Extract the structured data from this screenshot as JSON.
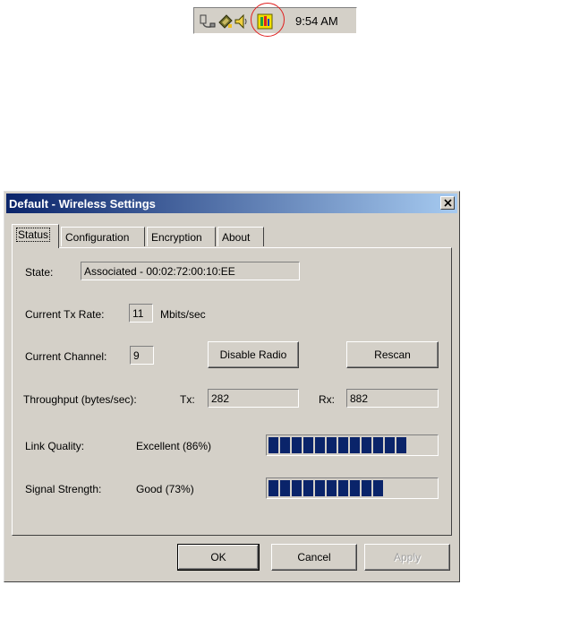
{
  "tray": {
    "clock": "9:54 AM",
    "icons": [
      "network-icon",
      "pc-card-icon",
      "speaker-icon",
      "wireless-utility-icon"
    ]
  },
  "window": {
    "title": "Default - Wireless Settings",
    "tabs": [
      {
        "label": "Status",
        "active": true
      },
      {
        "label": "Configuration",
        "active": false
      },
      {
        "label": "Encryption",
        "active": false
      },
      {
        "label": "About",
        "active": false
      }
    ],
    "status": {
      "state_label": "State:",
      "state_value": "Associated - 00:02:72:00:10:EE",
      "tx_rate_label": "Current Tx Rate:",
      "tx_rate_value": "11",
      "tx_rate_unit": "Mbits/sec",
      "channel_label": "Current Channel:",
      "channel_value": "9",
      "disable_radio_label": "Disable Radio",
      "rescan_label": "Rescan",
      "throughput_label": "Throughput (bytes/sec):",
      "tx_label": "Tx:",
      "tx_value": "282",
      "rx_label": "Rx:",
      "rx_value": "882",
      "link_quality_label": "Link Quality:",
      "link_quality_value": "Excellent (86%)",
      "link_quality_percent": 86,
      "signal_strength_label": "Signal Strength:",
      "signal_strength_value": "Good (73%)",
      "signal_strength_percent": 73
    },
    "buttons": {
      "ok": "OK",
      "cancel": "Cancel",
      "apply": "Apply"
    }
  },
  "colors": {
    "titlebar_start": "#0a246a",
    "titlebar_end": "#a6caf0",
    "face": "#d4d0c8",
    "bar_segment": "#0a246a",
    "highlight_circle": "#e02020"
  }
}
